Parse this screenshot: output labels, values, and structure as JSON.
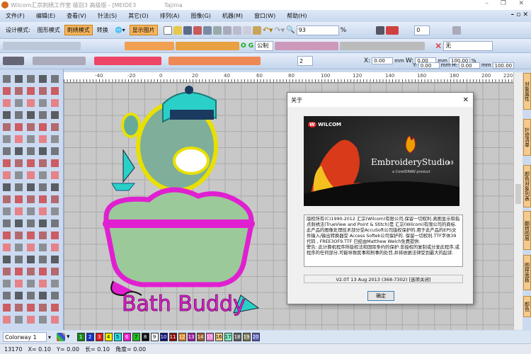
{
  "window": {
    "title": "Wilcom汇宗刺绣工作室  级别3 高级版 - [MEIDE3",
    "machine": "Tajima",
    "minimize": "–",
    "restore": "❐",
    "close": "✕"
  },
  "menu": [
    "文件(F)",
    "编辑(E)",
    "查看(V)",
    "针法(S)",
    "其它(O)",
    "排列(A)",
    "图像(G)",
    "机器(M)",
    "窗口(W)",
    "帮助(H)"
  ],
  "mdi_controls": "– ▫ ✕",
  "toolbar": {
    "design_mode_label": "设计模式:",
    "graphics_mode": "图形模式",
    "embroidery_mode": "刺绣模式",
    "convert": "转换",
    "show_picture": "显示图片",
    "zoom_value": "93",
    "zoom_unit": "%",
    "spin_value": "0",
    "stitch_type": "公制",
    "none_label": "无",
    "repeat_value": "2",
    "x_label": "X:",
    "x_value": "0.00",
    "y_label": "Y:",
    "y_value": "0.00",
    "w_label": "W:",
    "w_value": "0.00",
    "h_label": "H:",
    "h_value": "0.00",
    "unit": "mm",
    "pct_w": "100.00",
    "pct_h": "100.00",
    "pct": "%"
  },
  "ruler": [
    "-40",
    "-20",
    "0",
    "20",
    "40",
    "60",
    "80",
    "100",
    "120",
    "140",
    "160",
    "180",
    "200",
    "220"
  ],
  "design": {
    "text": "Bath Buddy"
  },
  "right_tabs": [
    "对象属性",
    "针迹清单",
    "颜色对象列表",
    "翻转图层",
    "图样面板",
    "颜色"
  ],
  "dialog": {
    "title": "关于",
    "close": "✕",
    "brand": "WILCOM",
    "product": "EmbroideryStudio",
    "edition": "e3",
    "coreldraw": "a CorelDRAW product",
    "about_text": "版权所有(C)1990-2012 汇宗(Wilcom)有限公司,保留一切权利.真图显示和指点刺绣法(TrueView and Point & Stitch)是 汇宗(Wilcom)有限公司的商标.此产品的图像处理技术部分受AccuSoft公司版权保护的.用于此产品的EPS文件输入/输出转换器受 Access Softek公司保护的. 保留一切权利.TTF字体39代码 , FREE3OF9.TTF 已经由Matthew Welch免费提供.\n警告: 此计算机程序所版权法和国际条约的保护.非授权的复制或分发此程序,或程序的任何部分,可能导致民事和刑事的处罚,并将依据法律受到最大的起诉.",
    "version": "V2.0T 13 Aug 2013 (368-7302) [选项关闭]",
    "ok": "确定"
  },
  "colorway": {
    "label": "Colorway 1",
    "swatches": [
      {
        "n": "1",
        "c": "#1a8a1a"
      },
      {
        "n": "2",
        "c": "#1530d0"
      },
      {
        "n": "3",
        "c": "#e01818"
      },
      {
        "n": "4",
        "c": "#f4f000"
      },
      {
        "n": "5",
        "c": "#22e0e0"
      },
      {
        "n": "6",
        "c": "#f020d0"
      },
      {
        "n": "7",
        "c": "#20c020"
      },
      {
        "n": "8",
        "c": "#111111"
      },
      {
        "n": "9",
        "c": "#ffffff"
      },
      {
        "n": "10",
        "c": "#101080"
      },
      {
        "n": "11",
        "c": "#8a1010"
      },
      {
        "n": "12",
        "c": "#e08a30"
      },
      {
        "n": "13",
        "c": "#a020a0"
      },
      {
        "n": "14",
        "c": "#a06030"
      },
      {
        "n": "15",
        "c": "#f080d0"
      },
      {
        "n": "16",
        "c": "#f0d080"
      },
      {
        "n": "17",
        "c": "#80f0c0"
      },
      {
        "n": "18",
        "c": "#606060"
      },
      {
        "n": "19",
        "c": "#808060"
      },
      {
        "n": "20",
        "c": "#6060c0"
      }
    ]
  },
  "status": {
    "count": "13170",
    "x": "X=  0.10",
    "y": "Y=  0.00",
    "len": "长=  0.10",
    "angle": "角度=  0.00"
  }
}
